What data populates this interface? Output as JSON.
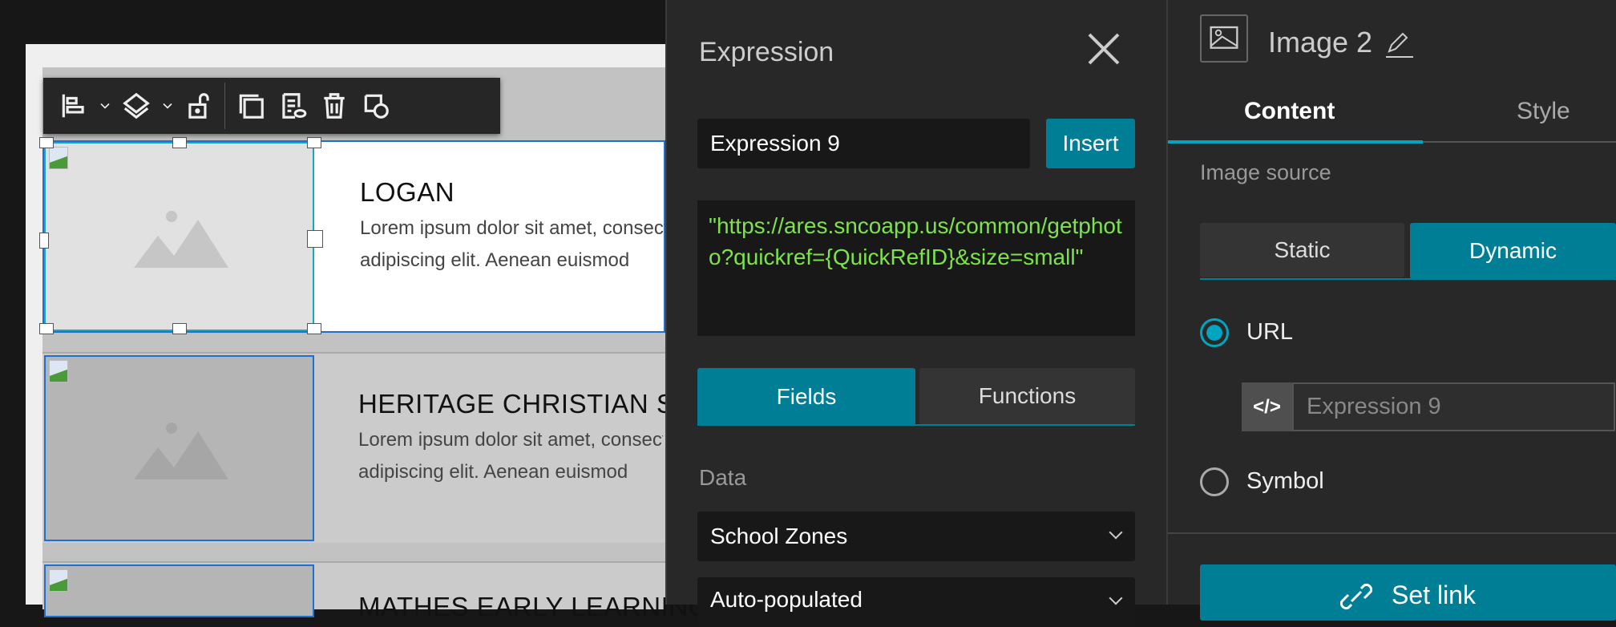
{
  "canvas": {
    "items": [
      {
        "title": "LOGAN",
        "desc_line1": "Lorem ipsum dolor sit amet, consectetur",
        "desc_line2": "adipiscing elit. Aenean euismod"
      },
      {
        "title": "HERITAGE CHRISTIAN SCHOOL",
        "desc_line1": "Lorem ipsum dolor sit amet, consectetur",
        "desc_line2": "adipiscing elit. Aenean euismod"
      },
      {
        "title": "MATHES EARLY LEARNING"
      }
    ]
  },
  "expression_panel": {
    "title": "Expression",
    "name_value": "Expression 9",
    "insert_label": "Insert",
    "code": "\"https://ares.sncoapp.us/common/getphoto?quickref={QuickRefID}&size=small\"",
    "tabs": [
      "Fields",
      "Functions"
    ],
    "data_label": "Data",
    "data_source": "School Zones",
    "second_select": "Auto-populated"
  },
  "settings_panel": {
    "title": "Image 2",
    "tabs": [
      "Content",
      "Style"
    ],
    "image_source_label": "Image source",
    "source_options": [
      "Static",
      "Dynamic"
    ],
    "url_label": "URL",
    "url_expression": "Expression 9",
    "symbol_label": "Symbol",
    "set_link_label": "Set link"
  },
  "colors": {
    "accent": "#007e96",
    "code": "#7ee24a"
  }
}
